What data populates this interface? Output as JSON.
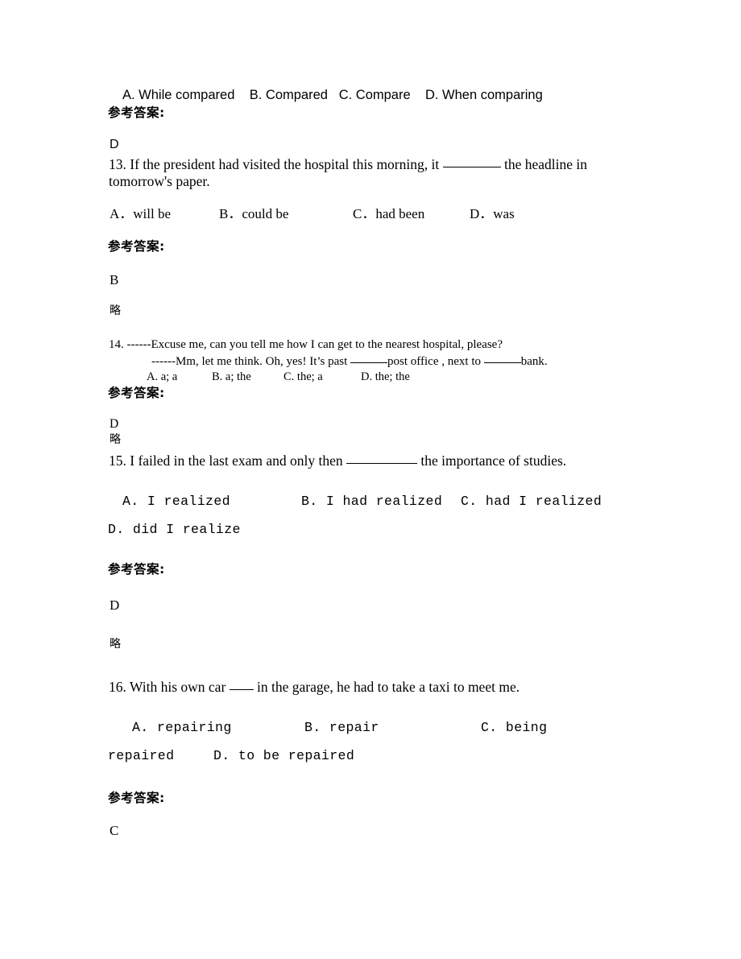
{
  "document": {
    "background_color": "#ffffff",
    "text_color": "#000000",
    "answer_heading": "参考答案:",
    "omitted_marker": "略"
  },
  "blocks": {
    "q12_options": {
      "options_line": "A. While compared    B. Compared   C. Compare    D. When comparing",
      "answer_heading": "参考答案:",
      "answer": "D"
    },
    "q13": {
      "number": "13.",
      "stem_part1": "13. If the president had visited the hospital this morning, it ",
      "stem_part2": " the headline in tomorrow's paper.",
      "options": [
        "A．will be",
        "B．could be",
        "C．had been",
        "D．was"
      ],
      "answer_heading": "参考答案:",
      "answer": "B",
      "omitted": "略"
    },
    "q14": {
      "stem_line1": "14. ------Excuse me, can you tell me how I can get to the nearest hospital, please?",
      "stem_line2_a": "------Mm, let me think. Oh, yes! It’s past ",
      "stem_line2_b": "post office , next to ",
      "stem_line2_c": "bank.",
      "options": [
        "A. a; a",
        "B. a; the",
        "C. the; a",
        "D. the; the"
      ],
      "answer_heading": "参考答案:",
      "answer": "D",
      "omitted": "略"
    },
    "q15": {
      "stem_part1": "15. I failed in the last exam and only then ",
      "stem_part2": " the importance of studies.",
      "options": [
        "A. I realized",
        "B. I had realized",
        "C. had I realized",
        "D. did I realize"
      ],
      "answer_heading": "参考答案:",
      "answer": "D",
      "omitted": "略"
    },
    "q16": {
      "stem_part1": "16. With his own car ",
      "stem_part2": " in the garage, he had to take a taxi to meet me.",
      "options": [
        "A. repairing",
        "B. repair",
        "C. being repaired",
        "D. to be repaired"
      ],
      "options_wrap_tail": "repaired",
      "options_c_head": "C. being",
      "answer_heading": "参考答案:",
      "answer": "C"
    }
  }
}
